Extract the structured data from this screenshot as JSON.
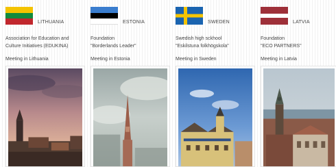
{
  "partners": [
    {
      "country": "LITHUANIA",
      "org_type": "Association for Education and",
      "org_name": "Culture Initiatives (EDUKINA)",
      "meeting": "Meeting in Lithuania",
      "flag_colors": [
        "#f4c300",
        "#128a3d",
        "#c1272d"
      ]
    },
    {
      "country": "ESTONIA",
      "org_type": "Foundation",
      "org_name": "\"Borderlands Leader\"",
      "meeting": "Meeting in Estonia",
      "flag_colors": [
        "#3a7dce",
        "#000000",
        "#ffffff"
      ]
    },
    {
      "country": "SWEDEN",
      "org_type": "Swedish high sckhool",
      "org_name": "\"Eskilstuna folkhögskola\"",
      "meeting": "Meeting in Sweden",
      "flag_colors": [
        "#1a64b0",
        "#f5c400"
      ]
    },
    {
      "country": "LATVIA",
      "org_type": "Foundation",
      "org_name": "\"ECO PARTNERS\"",
      "meeting": "Meeting in Latvia",
      "flag_colors": [
        "#9e3039",
        "#ffffff",
        "#9e3039"
      ]
    }
  ]
}
